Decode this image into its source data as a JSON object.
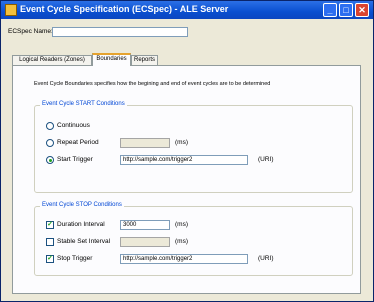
{
  "window": {
    "title": "Event Cycle Specification (ECSpec) - ALE Server",
    "controls": [
      "_",
      "□",
      "✕"
    ]
  },
  "spec_name": {
    "label": "ECSpec Name:",
    "value": ""
  },
  "tabs": [
    {
      "label": "Logical Readers (Zones)"
    },
    {
      "label": "Boundaries"
    },
    {
      "label": "Reports"
    }
  ],
  "boundaries": {
    "description": "Event Cycle Boundaries specifies how the begining and end of event cycles are to be determined",
    "start": {
      "title": "Event Cycle START Conditions",
      "continuous_label": "Continuous",
      "repeat_label": "Repeat Period",
      "repeat_value": "",
      "repeat_unit": "(ms)",
      "trigger_label": "Start Trigger",
      "trigger_value": "http://sample.com/trigger2",
      "trigger_unit": "(URI)"
    },
    "stop": {
      "title": "Event Cycle STOP Conditions",
      "duration_label": "Duration Interval",
      "duration_value": "3000",
      "duration_unit": "(ms)",
      "stable_label": "Stable Set Interval",
      "stable_value": "",
      "stable_unit": "(ms)",
      "trigger_label": "Stop Trigger",
      "trigger_value": "http://sample.com/trigger2",
      "trigger_unit": "(URI)"
    }
  },
  "controls_state": {
    "start_selected": "Start Trigger",
    "duration_checked": true,
    "stable_checked": false,
    "stop_trigger_checked": true
  }
}
